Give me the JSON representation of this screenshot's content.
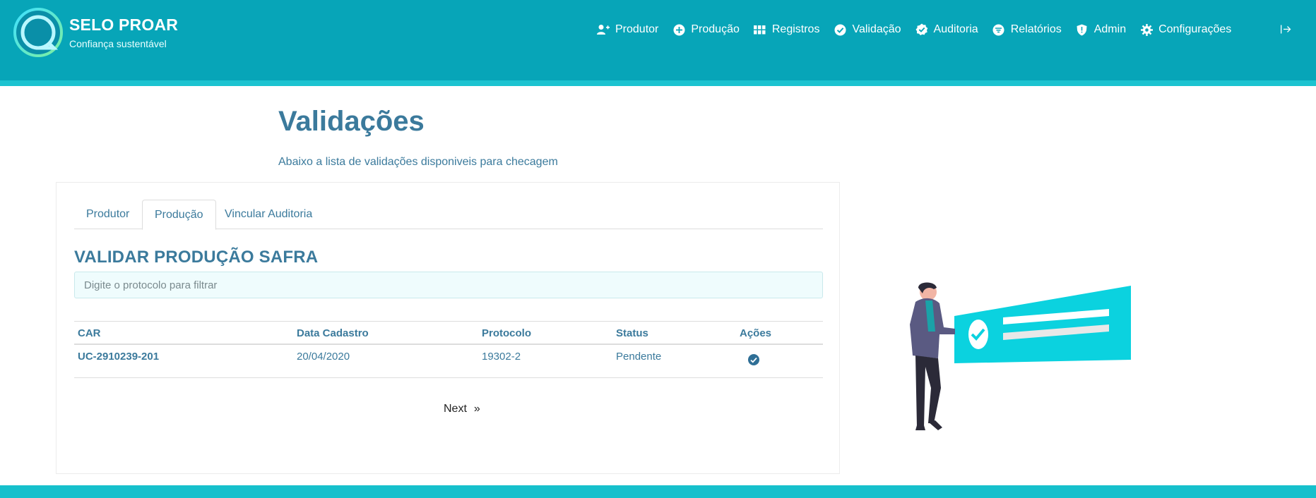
{
  "brand": {
    "title": "SELO PROAR",
    "subtitle": "Confiança sustentável"
  },
  "nav": {
    "items": [
      {
        "label": "Produtor",
        "icon": "user-plus-icon"
      },
      {
        "label": "Produção",
        "icon": "plus-circle-icon"
      },
      {
        "label": "Registros",
        "icon": "grid-icon"
      },
      {
        "label": "Validação",
        "icon": "check-circle-icon"
      },
      {
        "label": "Auditoria",
        "icon": "check-badge-icon"
      },
      {
        "label": "Relatórios",
        "icon": "filter-circle-icon"
      },
      {
        "label": "Admin",
        "icon": "shield-icon"
      },
      {
        "label": "Configurações",
        "icon": "gear-icon"
      }
    ],
    "logout_icon": "logout-icon"
  },
  "page": {
    "title": "Validações",
    "description": "Abaixo a lista de validações disponiveis para checagem"
  },
  "tabs": [
    {
      "label": "Produtor",
      "active": false
    },
    {
      "label": "Produção",
      "active": true
    },
    {
      "label": "Vincular Auditoria",
      "active": false
    }
  ],
  "section": {
    "title": "VALIDAR PRODUÇÃO SAFRA",
    "filter_placeholder": "Digite o protocolo para filtrar",
    "filter_value": ""
  },
  "table": {
    "headers": [
      "CAR",
      "Data Cadastro",
      "Protocolo",
      "Status",
      "Ações"
    ],
    "rows": [
      {
        "car": "UC-2910239-201",
        "data_cadastro": "20/04/2020",
        "protocolo": "19302-2",
        "status": "Pendente",
        "action_icon": "check-circle-icon"
      }
    ]
  },
  "pagination": {
    "next_label": "Next",
    "arrow": "»"
  },
  "colors": {
    "header": "#07a5b8",
    "accent": "#1cc3d0",
    "text": "#3b7a9c",
    "action": "#2f6f96"
  }
}
